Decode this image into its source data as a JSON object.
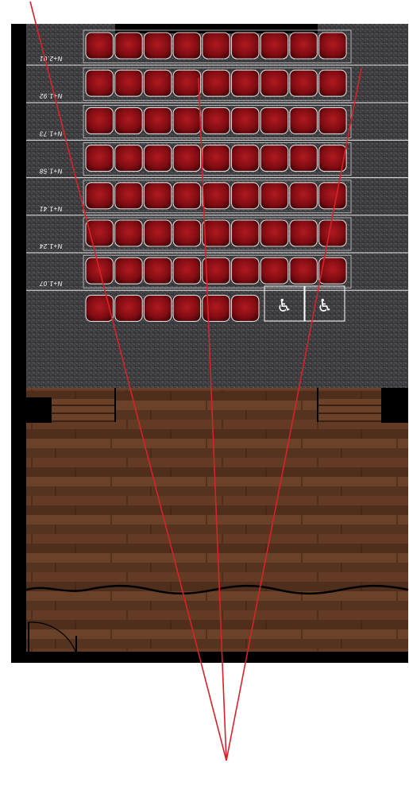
{
  "plan": {
    "title": "",
    "seat_color": "#8c0f14",
    "floor_color": "#5a3520",
    "carpet_color": "#3a3a3c",
    "sightline_color": "#d8222a",
    "rows": [
      {
        "label": "N+2.01",
        "seats": 9
      },
      {
        "label": "N+1.92",
        "seats": 9
      },
      {
        "label": "N+1.73",
        "seats": 9
      },
      {
        "label": "N+1.58",
        "seats": 9
      },
      {
        "label": "N+1.41",
        "seats": 9
      },
      {
        "label": "N+1.24",
        "seats": 9
      },
      {
        "label": "N+1.07",
        "seats": 9
      },
      {
        "label": "",
        "seats": 6
      }
    ],
    "wheelchair_spaces": [
      {
        "icon": "wheelchair-icon"
      },
      {
        "icon": "wheelchair-icon"
      }
    ],
    "sightlines": 3
  }
}
